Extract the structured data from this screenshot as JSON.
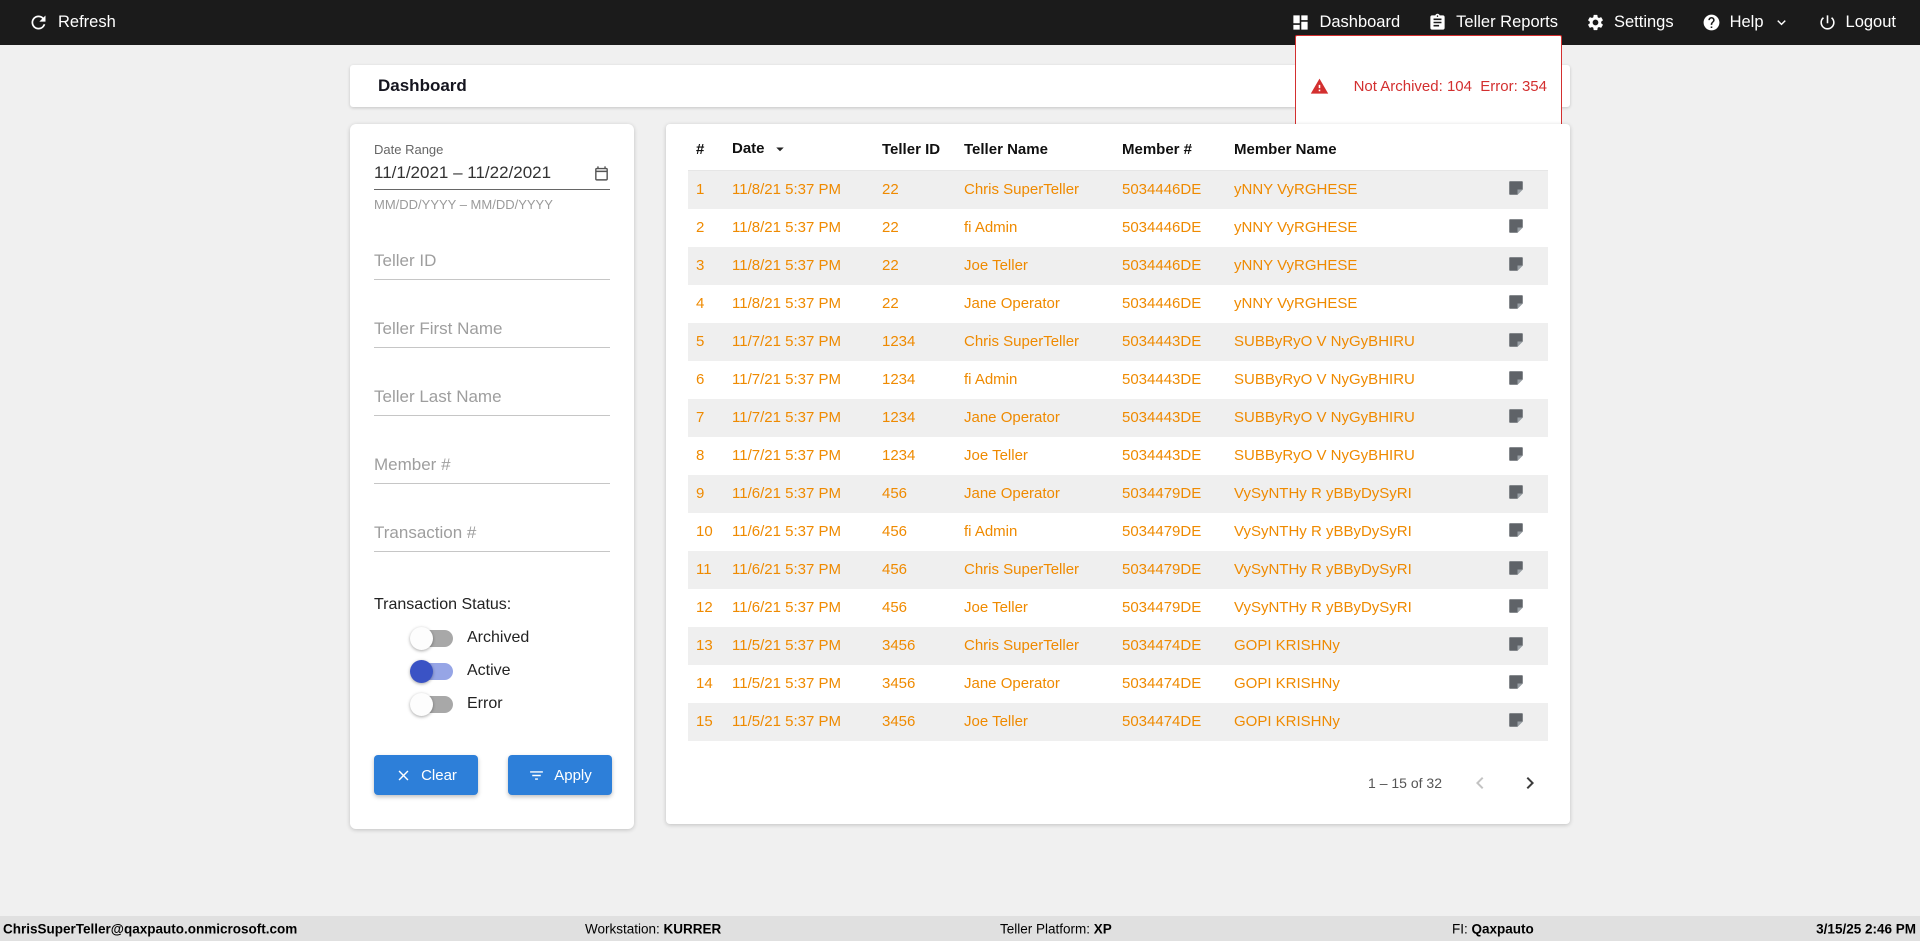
{
  "colors": {
    "accent": "#2D7FD9",
    "row-text": "#EF8A00",
    "alert": "#D32F2F",
    "toggle-on": "#3A53C5",
    "toggle-on-track": "#96A5E6",
    "nav-bg": "#1B1B1B"
  },
  "topnav": {
    "refresh_label": "Refresh",
    "dashboard_label": "Dashboard",
    "reports_label": "Teller Reports",
    "settings_label": "Settings",
    "help_label": "Help",
    "logout_label": "Logout"
  },
  "header": {
    "title": "Dashboard",
    "alert_text": "Not Archived: 104  Error: 354"
  },
  "filters": {
    "date_range_label": "Date Range",
    "date_range_value": "11/1/2021 – 11/22/2021",
    "date_range_hint": "MM/DD/YYYY – MM/DD/YYYY",
    "teller_id_placeholder": "Teller ID",
    "teller_first_placeholder": "Teller First Name",
    "teller_last_placeholder": "Teller Last Name",
    "member_placeholder": "Member #",
    "transaction_placeholder": "Transaction #",
    "status_label": "Transaction Status:",
    "toggles": [
      {
        "label": "Archived",
        "on": false
      },
      {
        "label": "Active",
        "on": true
      },
      {
        "label": "Error",
        "on": false
      }
    ],
    "clear_label": "Clear",
    "apply_label": "Apply"
  },
  "table": {
    "columns": [
      "#",
      "Date",
      "Teller ID",
      "Teller Name",
      "Member #",
      "Member Name"
    ],
    "rows": [
      {
        "num": "1",
        "date": "11/8/21 5:37 PM",
        "teller_id": "22",
        "teller_name": "Chris SuperTeller",
        "member_num": "5034446DE",
        "member_name": "yNNY VyRGHESE"
      },
      {
        "num": "2",
        "date": "11/8/21 5:37 PM",
        "teller_id": "22",
        "teller_name": "fi Admin",
        "member_num": "5034446DE",
        "member_name": "yNNY VyRGHESE"
      },
      {
        "num": "3",
        "date": "11/8/21 5:37 PM",
        "teller_id": "22",
        "teller_name": "Joe Teller",
        "member_num": "5034446DE",
        "member_name": "yNNY VyRGHESE"
      },
      {
        "num": "4",
        "date": "11/8/21 5:37 PM",
        "teller_id": "22",
        "teller_name": "Jane Operator",
        "member_num": "5034446DE",
        "member_name": "yNNY VyRGHESE"
      },
      {
        "num": "5",
        "date": "11/7/21 5:37 PM",
        "teller_id": "1234",
        "teller_name": "Chris SuperTeller",
        "member_num": "5034443DE",
        "member_name": "SUBByRyO V NyGyBHIRU"
      },
      {
        "num": "6",
        "date": "11/7/21 5:37 PM",
        "teller_id": "1234",
        "teller_name": "fi Admin",
        "member_num": "5034443DE",
        "member_name": "SUBByRyO V NyGyBHIRU"
      },
      {
        "num": "7",
        "date": "11/7/21 5:37 PM",
        "teller_id": "1234",
        "teller_name": "Jane Operator",
        "member_num": "5034443DE",
        "member_name": "SUBByRyO V NyGyBHIRU"
      },
      {
        "num": "8",
        "date": "11/7/21 5:37 PM",
        "teller_id": "1234",
        "teller_name": "Joe Teller",
        "member_num": "5034443DE",
        "member_name": "SUBByRyO V NyGyBHIRU"
      },
      {
        "num": "9",
        "date": "11/6/21 5:37 PM",
        "teller_id": "456",
        "teller_name": "Jane Operator",
        "member_num": "5034479DE",
        "member_name": "VySyNTHy R yBByDySyRI"
      },
      {
        "num": "10",
        "date": "11/6/21 5:37 PM",
        "teller_id": "456",
        "teller_name": "fi Admin",
        "member_num": "5034479DE",
        "member_name": "VySyNTHy R yBByDySyRI"
      },
      {
        "num": "11",
        "date": "11/6/21 5:37 PM",
        "teller_id": "456",
        "teller_name": "Chris SuperTeller",
        "member_num": "5034479DE",
        "member_name": "VySyNTHy R yBByDySyRI"
      },
      {
        "num": "12",
        "date": "11/6/21 5:37 PM",
        "teller_id": "456",
        "teller_name": "Joe Teller",
        "member_num": "5034479DE",
        "member_name": "VySyNTHy R yBByDySyRI"
      },
      {
        "num": "13",
        "date": "11/5/21 5:37 PM",
        "teller_id": "3456",
        "teller_name": "Chris SuperTeller",
        "member_num": "5034474DE",
        "member_name": "GOPI KRISHNy"
      },
      {
        "num": "14",
        "date": "11/5/21 5:37 PM",
        "teller_id": "3456",
        "teller_name": "Jane Operator",
        "member_num": "5034474DE",
        "member_name": "GOPI KRISHNy"
      },
      {
        "num": "15",
        "date": "11/5/21 5:37 PM",
        "teller_id": "3456",
        "teller_name": "Joe Teller",
        "member_num": "5034474DE",
        "member_name": "GOPI KRISHNy"
      }
    ],
    "pagination": "1 – 15 of 32"
  },
  "statusbar": {
    "user": "ChrisSuperTeller@qaxpauto.onmicrosoft.com",
    "workstation_label": "Workstation:",
    "workstation_value": "KURRER",
    "platform_label": "Teller Platform:",
    "platform_value": "XP",
    "fi_label": "FI:",
    "fi_value": "Qaxpauto",
    "datetime": "3/15/25 2:46 PM"
  }
}
